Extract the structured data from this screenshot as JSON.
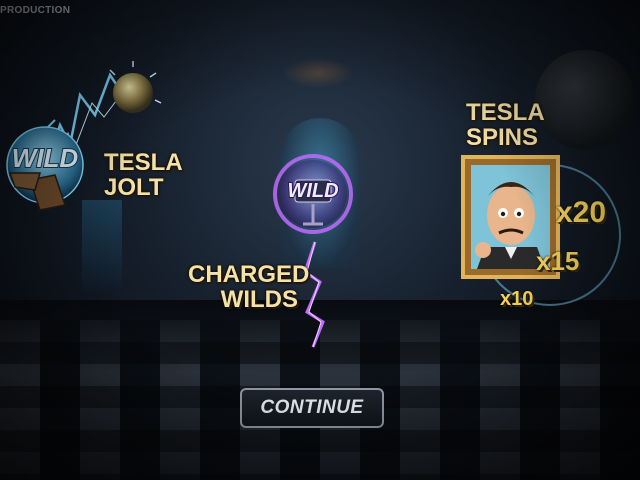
{
  "top_label": "PRODUCTION",
  "features": {
    "tesla_jolt": "TESLA\nJOLT",
    "charged_wilds": "CHARGED\nWILDS",
    "tesla_spins": "TESLA\nSPINS"
  },
  "wild_label": "WILD",
  "multipliers": [
    "x20",
    "x15",
    "x10"
  ],
  "continue_label": "CONTINUE",
  "colors": {
    "feature_text": "#f4e2a8",
    "multiplier": "#f4d25a",
    "electric_blue": "#7fd8ff",
    "electric_purple": "#c06bff"
  }
}
